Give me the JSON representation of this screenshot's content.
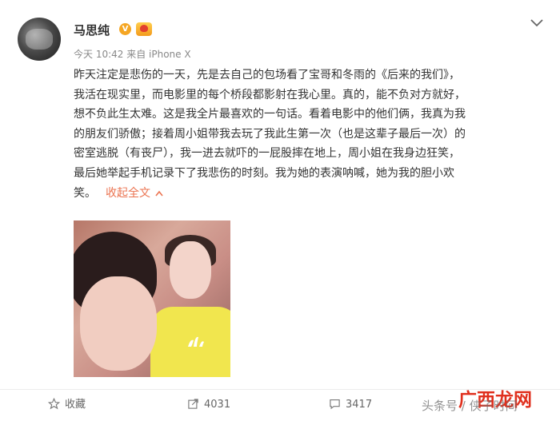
{
  "post": {
    "username": "马思纯",
    "verified_badge": "V",
    "meta": "今天 10:42 来自 iPhone X",
    "lines": [
      "昨天注定是悲伤的一天，先是去自己的包场看了宝哥和冬雨的《后来的我们》，",
      "我活在现实里，而电影里的每个桥段都影射在我心里。真的，能不负对方就好，",
      "想不负此生太难。这是我全片最喜欢的一句话。看着电影中的他们俩，我真为我",
      "的朋友们骄傲；接着周小姐带我去玩了我此生第一次（也是这辈子最后一次）的",
      "密室逃脱（有丧尸），我一进去就吓的一屁股摔在地上，周小姐在我身边狂笑，",
      "最后她举起手机记录下了我悲伤的时刻。我为她的表演呐喊，她为我的胆小欢"
    ],
    "last_line": "笑。",
    "collapse_label": "收起全文",
    "accent_color": "#eb7350"
  },
  "actions": {
    "favorite_label": "收藏",
    "repost_count": "4031",
    "comment_count": "3417"
  },
  "watermark": {
    "text": "头条号 / 侠子时间",
    "logo_text": "广西龙网"
  },
  "icons": [
    "more-chevron-icon",
    "star-icon",
    "repost-icon",
    "comment-icon",
    "collapse-chevron-icon"
  ]
}
